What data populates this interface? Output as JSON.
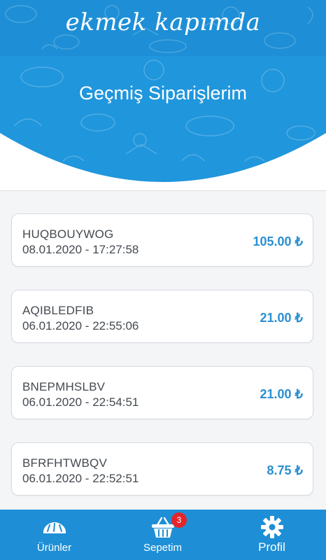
{
  "header": {
    "brand": "ekmek kapımda",
    "page_title": "Geçmiş Siparişlerim"
  },
  "orders": [
    {
      "code": "HUQBOUYWOG",
      "date": "08.01.2020 - 17:27:58",
      "total": "105.00 ₺"
    },
    {
      "code": "AQIBLEDFIB",
      "date": "06.01.2020 - 22:55:06",
      "total": "21.00 ₺"
    },
    {
      "code": "BNEPMHSLBV",
      "date": "06.01.2020 - 22:54:51",
      "total": "21.00 ₺"
    },
    {
      "code": "BFRFHTWBQV",
      "date": "06.01.2020 - 22:52:51",
      "total": "8.75 ₺"
    }
  ],
  "bottom_nav": {
    "products_label": "Ürünler",
    "products_icon": "bread-icon",
    "cart_label": "Sepetim",
    "cart_icon": "basket-icon",
    "cart_badge": "3",
    "profile_label": "Profil",
    "profile_icon": "gear-icon"
  },
  "colors": {
    "primary": "#1e8fd6",
    "price": "#2b8fd2",
    "badge": "#e3262b"
  }
}
